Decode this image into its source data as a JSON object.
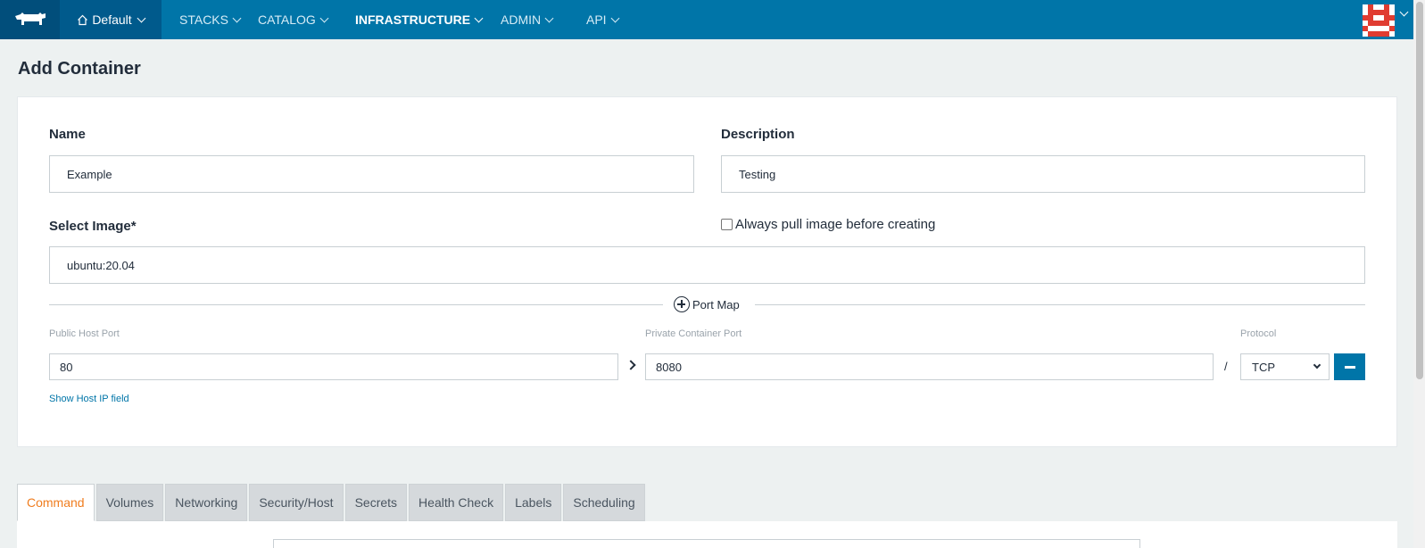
{
  "nav": {
    "environment": "Default",
    "items": [
      {
        "label": "STACKS",
        "active": false
      },
      {
        "label": "CATALOG",
        "active": false
      },
      {
        "label": "INFRASTRUCTURE",
        "active": true
      },
      {
        "label": "ADMIN",
        "active": false
      },
      {
        "label": "API",
        "active": false
      }
    ]
  },
  "page": {
    "title": "Add Container"
  },
  "form": {
    "name_label": "Name",
    "name_value": "Example",
    "description_label": "Description",
    "description_value": "Testing",
    "image_label": "Select Image*",
    "image_value": "ubuntu:20.04",
    "pull_image_label": "Always pull image before creating",
    "pull_image_checked": false
  },
  "port_map": {
    "add_label": "Port Map",
    "public_port_label": "Public Host Port",
    "public_port_value": "80",
    "private_port_label": "Private Container Port",
    "private_port_value": "8080",
    "separator": "/",
    "protocol_label": "Protocol",
    "protocol_value": "TCP",
    "show_host_ip_link": "Show Host IP field"
  },
  "tabs": [
    {
      "label": "Command",
      "active": true
    },
    {
      "label": "Volumes",
      "active": false
    },
    {
      "label": "Networking",
      "active": false
    },
    {
      "label": "Security/Host",
      "active": false
    },
    {
      "label": "Secrets",
      "active": false
    },
    {
      "label": "Health Check",
      "active": false
    },
    {
      "label": "Labels",
      "active": false
    },
    {
      "label": "Scheduling",
      "active": false
    }
  ],
  "colors": {
    "nav_bg": "#0075a8",
    "logo_bg": "#014e7b",
    "env_bg": "#005a8c",
    "accent": "#0075a8",
    "active_tab_text": "#f07d1f",
    "page_bg": "#edf1f1"
  },
  "icons": {
    "logo": "rancher-cow-logo",
    "env": "home-icon",
    "port_map": "plus-circle-icon",
    "arrow": "chevron-right-icon",
    "remove": "minus-icon",
    "avatar": "identicon-avatar"
  }
}
